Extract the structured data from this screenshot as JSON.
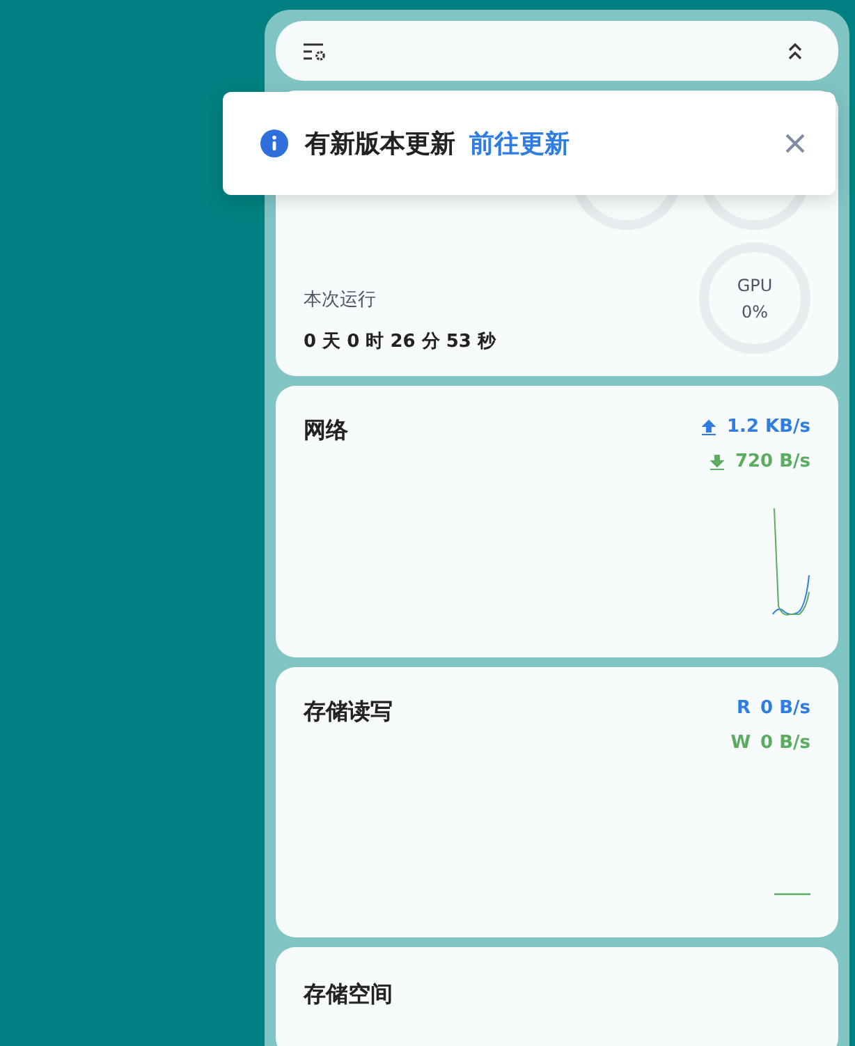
{
  "notification": {
    "message": "有新版本更新",
    "link": "前往更新"
  },
  "overview": {
    "gauges": [
      {
        "label": "GPU",
        "value": "0%"
      }
    ],
    "uptime_label": "本次运行",
    "uptime": "0 天 0 时 26 分 53 秒"
  },
  "network": {
    "title": "网络",
    "upload": "1.2 KB/s",
    "download": "720 B/s"
  },
  "storage_io": {
    "title": "存储读写",
    "read_label": "R",
    "read": "0 B/s",
    "write_label": "W",
    "write": "0 B/s"
  },
  "storage_space": {
    "title": "存储空间"
  }
}
